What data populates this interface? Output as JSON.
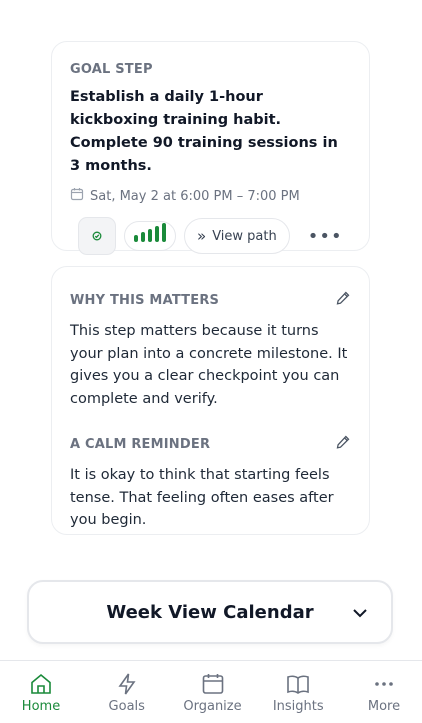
{
  "goal_card": {
    "overline": "GOAL STEP",
    "title": "Establish a daily 1-hour kickboxing training habit. Complete 90 training sessions in 3 months.",
    "schedule": "Sat, May 2 at 6:00 PM – 7:00 PM",
    "view_path_label": "View path",
    "level_bars": 5,
    "accent_color": "#1a8a3a"
  },
  "why_card": {
    "why_heading": "WHY THIS MATTERS",
    "why_text": "This step matters because it turns your plan into a concrete milestone. It gives you a clear checkpoint you can complete and verify.",
    "reminder_heading": "A CALM REMINDER",
    "reminder_text": "It is okay to think that starting feels tense. That feeling often eases after you begin."
  },
  "week_calendar": {
    "label": "Week View Calendar"
  },
  "tabbar": {
    "items": [
      {
        "label": "Home",
        "icon": "home-icon",
        "active": true
      },
      {
        "label": "Goals",
        "icon": "bolt-icon",
        "active": false
      },
      {
        "label": "Organize",
        "icon": "calendar-icon",
        "active": false
      },
      {
        "label": "Insights",
        "icon": "book-icon",
        "active": false
      },
      {
        "label": "More",
        "icon": "more-icon",
        "active": false
      }
    ]
  }
}
